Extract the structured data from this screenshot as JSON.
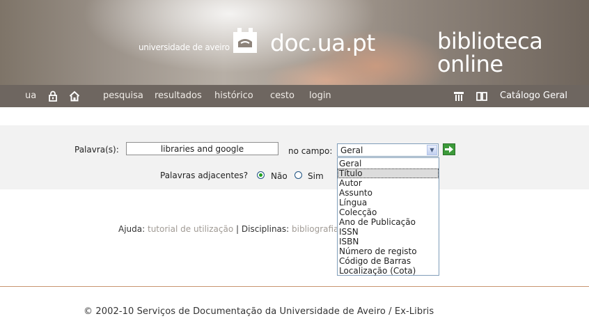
{
  "header": {
    "university": "universidade de aveiro",
    "site_title": "doc.ua.pt",
    "library_line1": "biblioteca",
    "library_line2": "online"
  },
  "nav": {
    "ua": "ua",
    "links": [
      "pesquisa",
      "resultados",
      "histórico",
      "cesto",
      "login"
    ],
    "catalog": "Catálogo Geral",
    "icons": [
      "lock-icon",
      "home-icon",
      "catalog-icon",
      "book-icon"
    ]
  },
  "search": {
    "words_label": "Palavra(s):",
    "words_value": "libraries and google",
    "field_label": "no campo:",
    "field_selected": "Geral",
    "adjacent_label": "Palavras adjacentes?",
    "adjacent_no": "Não",
    "adjacent_yes": "Sim",
    "adjacent_selected": "Não"
  },
  "dropdown": {
    "options": [
      "Geral",
      "Título",
      "Autor",
      "Assunto",
      "Língua",
      "Colecção",
      "Ano de Publicação",
      "ISSN",
      "ISBN",
      "Número de registo",
      "Código de Barras",
      "Localização (Cota)"
    ],
    "highlighted": "Título"
  },
  "help": {
    "help_label": "Ajuda:",
    "help_link": "tutorial de utilização",
    "separator": "|",
    "disciplines_label": "Disciplinas:",
    "disciplines_link": "bibliografia re"
  },
  "footer": {
    "text": "© 2002-10 Serviços de Documentação da Universidade de Aveiro / Ex-Libris"
  },
  "colors": {
    "nav_bg": "#6e6660",
    "go_button": "#3c9a3a",
    "rule": "#c89470"
  }
}
